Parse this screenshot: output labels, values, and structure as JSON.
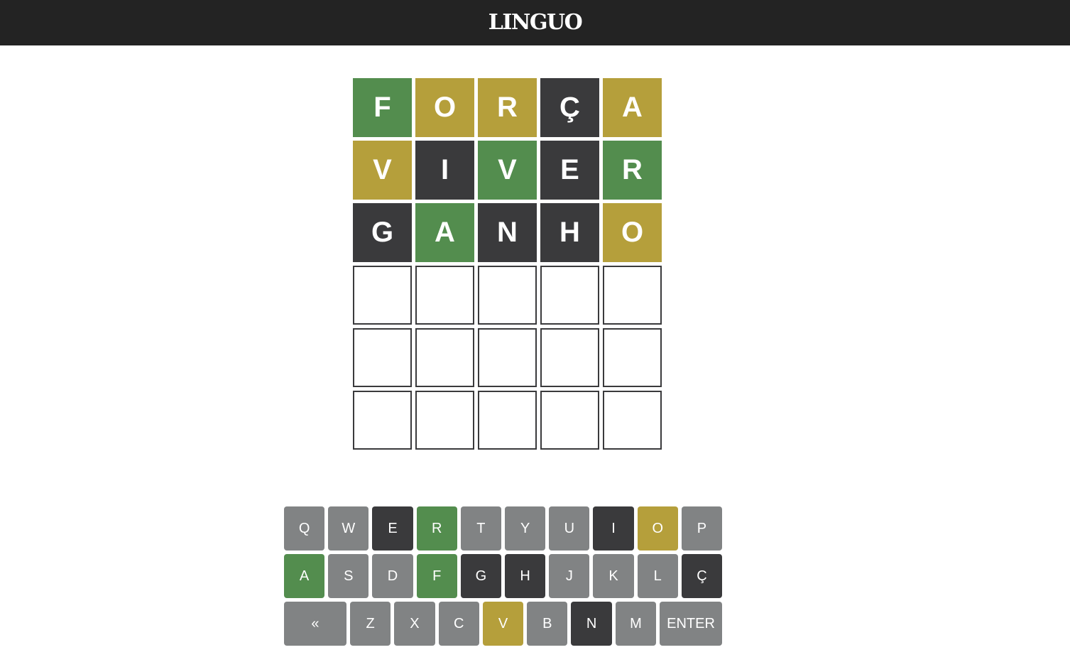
{
  "header": {
    "title": "LINGUO"
  },
  "colors": {
    "header_bg": "#232323",
    "correct": "#538d4e",
    "present": "#b59f3b",
    "absent": "#3a3a3c",
    "unused_key": "#818384",
    "empty_border": "#3a3a3c"
  },
  "board": {
    "rows": [
      [
        {
          "letter": "F",
          "state": "correct"
        },
        {
          "letter": "O",
          "state": "present"
        },
        {
          "letter": "R",
          "state": "present"
        },
        {
          "letter": "Ç",
          "state": "absent"
        },
        {
          "letter": "A",
          "state": "present"
        }
      ],
      [
        {
          "letter": "V",
          "state": "present"
        },
        {
          "letter": "I",
          "state": "absent"
        },
        {
          "letter": "V",
          "state": "correct"
        },
        {
          "letter": "E",
          "state": "absent"
        },
        {
          "letter": "R",
          "state": "correct"
        }
      ],
      [
        {
          "letter": "G",
          "state": "absent"
        },
        {
          "letter": "A",
          "state": "correct"
        },
        {
          "letter": "N",
          "state": "absent"
        },
        {
          "letter": "H",
          "state": "absent"
        },
        {
          "letter": "O",
          "state": "present"
        }
      ],
      [
        {
          "letter": "",
          "state": "empty"
        },
        {
          "letter": "",
          "state": "empty"
        },
        {
          "letter": "",
          "state": "empty"
        },
        {
          "letter": "",
          "state": "empty"
        },
        {
          "letter": "",
          "state": "empty"
        }
      ],
      [
        {
          "letter": "",
          "state": "empty"
        },
        {
          "letter": "",
          "state": "empty"
        },
        {
          "letter": "",
          "state": "empty"
        },
        {
          "letter": "",
          "state": "empty"
        },
        {
          "letter": "",
          "state": "empty"
        }
      ],
      [
        {
          "letter": "",
          "state": "empty"
        },
        {
          "letter": "",
          "state": "empty"
        },
        {
          "letter": "",
          "state": "empty"
        },
        {
          "letter": "",
          "state": "empty"
        },
        {
          "letter": "",
          "state": "empty"
        }
      ]
    ]
  },
  "keyboard": {
    "rows": [
      [
        {
          "label": "Q",
          "state": "unused"
        },
        {
          "label": "W",
          "state": "unused"
        },
        {
          "label": "E",
          "state": "absent"
        },
        {
          "label": "R",
          "state": "correct"
        },
        {
          "label": "T",
          "state": "unused"
        },
        {
          "label": "Y",
          "state": "unused"
        },
        {
          "label": "U",
          "state": "unused"
        },
        {
          "label": "I",
          "state": "absent"
        },
        {
          "label": "O",
          "state": "present"
        },
        {
          "label": "P",
          "state": "unused"
        }
      ],
      [
        {
          "label": "A",
          "state": "correct"
        },
        {
          "label": "S",
          "state": "unused"
        },
        {
          "label": "D",
          "state": "unused"
        },
        {
          "label": "F",
          "state": "correct"
        },
        {
          "label": "G",
          "state": "absent"
        },
        {
          "label": "H",
          "state": "absent"
        },
        {
          "label": "J",
          "state": "unused"
        },
        {
          "label": "K",
          "state": "unused"
        },
        {
          "label": "L",
          "state": "unused"
        },
        {
          "label": "Ç",
          "state": "absent"
        }
      ],
      [
        {
          "label": "«",
          "state": "unused",
          "action": "backspace"
        },
        {
          "label": "Z",
          "state": "unused"
        },
        {
          "label": "X",
          "state": "unused"
        },
        {
          "label": "C",
          "state": "unused"
        },
        {
          "label": "V",
          "state": "present"
        },
        {
          "label": "B",
          "state": "unused"
        },
        {
          "label": "N",
          "state": "absent"
        },
        {
          "label": "M",
          "state": "unused"
        },
        {
          "label": "ENTER",
          "state": "unused",
          "action": "enter"
        }
      ]
    ]
  }
}
